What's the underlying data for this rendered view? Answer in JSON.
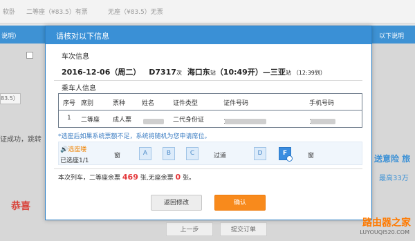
{
  "bg": {
    "top_items": [
      "软卧",
      "二等座（¥83.5）有票",
      "无座（¥83.5）无票"
    ],
    "head_left": "说明）",
    "head_right": "以下说明",
    "left_price": "83.5）",
    "left_msg": "证成功，跳转",
    "left_red": "恭喜",
    "right_ad": "送意险 旅",
    "right_ad2": "最高33万",
    "btn_prev": "上一步",
    "btn_submit": "提交订单",
    "watermark": "路由器之家",
    "watermark_url": "LUYOUQI520.COM"
  },
  "modal": {
    "title": "请核对以下信息",
    "train_section": "车次信息",
    "date": "2016-12-06（周二）",
    "train_no": "D7317",
    "train_suffix": "次",
    "from": "海口东",
    "from_suffix": "站",
    "depart": "（10:49开）",
    "arrow": "—",
    "to": "三亚",
    "to_suffix": "站",
    "arrive": "（12:39到）",
    "passenger_section": "乘车人信息",
    "headers": [
      "序号",
      "席别",
      "票种",
      "姓名",
      "证件类型",
      "证件号码",
      "手机号码"
    ],
    "row": [
      "1",
      "二等座",
      "成人票",
      "",
      "二代身份证",
      "130",
      "132"
    ],
    "note": "*选座后如果系统票额不足，系统将随机为您申请席位。",
    "select_label": "选座喽",
    "selected_count": "已选座1/1",
    "window_left": "窗",
    "aisle": "过道",
    "window_right": "窗",
    "seats": [
      "A",
      "B",
      "C",
      "D",
      "F"
    ],
    "remain_prefix": "本次列车，二等座余票",
    "remain_count": "469",
    "remain_mid": "张,无座余票",
    "remain_none": "0",
    "remain_suffix": "张。",
    "back_label": "返回修改",
    "confirm_label": "确认"
  },
  "colors": {
    "accent": "#3a90d6",
    "confirm": "#f88a1c",
    "alert": "#e4393c"
  }
}
